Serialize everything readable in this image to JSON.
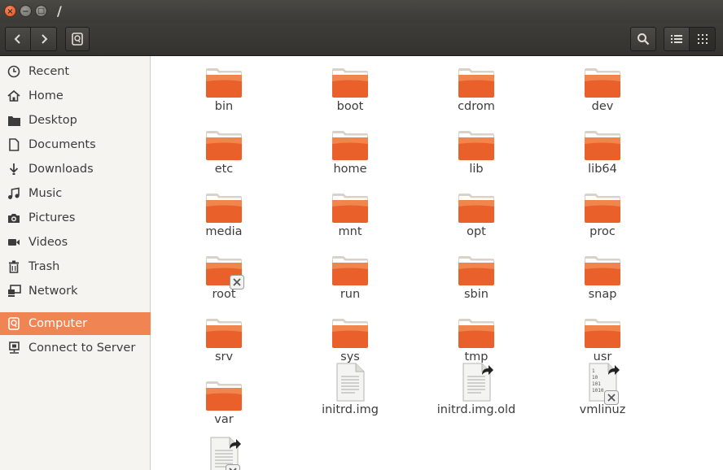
{
  "window": {
    "title": "/"
  },
  "window_buttons": {
    "close": "×",
    "minimize": "−",
    "maximize": "□"
  },
  "sidebar": {
    "items": [
      {
        "label": "Recent",
        "icon": "clock-icon"
      },
      {
        "label": "Home",
        "icon": "home-icon"
      },
      {
        "label": "Desktop",
        "icon": "desktop-folder-icon"
      },
      {
        "label": "Documents",
        "icon": "document-icon"
      },
      {
        "label": "Downloads",
        "icon": "download-icon"
      },
      {
        "label": "Music",
        "icon": "music-icon"
      },
      {
        "label": "Pictures",
        "icon": "camera-icon"
      },
      {
        "label": "Videos",
        "icon": "video-icon"
      },
      {
        "label": "Trash",
        "icon": "trash-icon"
      },
      {
        "label": "Network",
        "icon": "network-icon"
      },
      {
        "label": "Computer",
        "icon": "drive-icon",
        "active": true
      },
      {
        "label": "Connect to Server",
        "icon": "server-icon"
      }
    ]
  },
  "files": [
    {
      "name": "bin",
      "type": "folder"
    },
    {
      "name": "boot",
      "type": "folder"
    },
    {
      "name": "cdrom",
      "type": "folder"
    },
    {
      "name": "dev",
      "type": "folder"
    },
    {
      "name": "etc",
      "type": "folder"
    },
    {
      "name": "home",
      "type": "folder"
    },
    {
      "name": "lib",
      "type": "folder"
    },
    {
      "name": "lib64",
      "type": "folder"
    },
    {
      "name": "media",
      "type": "folder"
    },
    {
      "name": "mnt",
      "type": "folder"
    },
    {
      "name": "opt",
      "type": "folder"
    },
    {
      "name": "proc",
      "type": "folder"
    },
    {
      "name": "root",
      "type": "folder-locked"
    },
    {
      "name": "run",
      "type": "folder"
    },
    {
      "name": "sbin",
      "type": "folder"
    },
    {
      "name": "snap",
      "type": "folder"
    },
    {
      "name": "srv",
      "type": "folder"
    },
    {
      "name": "sys",
      "type": "folder"
    },
    {
      "name": "tmp",
      "type": "folder"
    },
    {
      "name": "usr",
      "type": "folder"
    },
    {
      "name": "var",
      "type": "folder"
    },
    {
      "name": "initrd.img",
      "type": "file"
    },
    {
      "name": "initrd.img.old",
      "type": "file-link"
    },
    {
      "name": "vmlinuz",
      "type": "binary-link-locked"
    },
    {
      "name": "",
      "type": "file-link-locked"
    }
  ],
  "colors": {
    "accent": "#f08452",
    "folder": "#e9602a",
    "titlebar": "#3c3b37"
  }
}
